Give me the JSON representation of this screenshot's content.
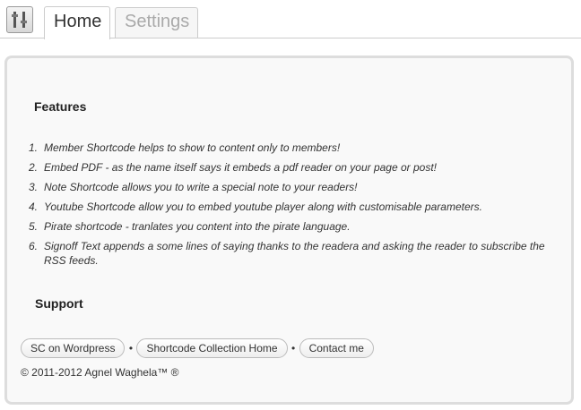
{
  "tabs": {
    "home": "Home",
    "settings": "Settings"
  },
  "features": {
    "heading": "Features",
    "items": [
      {
        "num": "1.",
        "text": "Member Shortcode helps to show to content only to members!"
      },
      {
        "num": "2.",
        "text": "Embed PDF - as the name itself says it embeds a pdf reader on your page or post!"
      },
      {
        "num": "3.",
        "text": "Note Shortcode allows you to write a special note to your readers!"
      },
      {
        "num": "4.",
        "text": "Youtube Shortcode allow you to embed youtube player along with customisable parameters."
      },
      {
        "num": "5.",
        "text": "Pirate shortcode - tranlates you content into the pirate language."
      },
      {
        "num": "6.",
        "text": "Signoff Text appends a some lines of saying thanks to the readera and asking the reader to subscribe the RSS feeds."
      }
    ]
  },
  "support": {
    "heading": "Support",
    "links": [
      "SC on Wordpress",
      "Shortcode Collection Home",
      "Contact me"
    ],
    "separator": "•",
    "copyright": "© 2011-2012 Agnel Waghela™ ®"
  },
  "colors": {
    "panel_background": "#f9f9f9",
    "panel_border": "#dddddd",
    "tab_border": "#cccccc",
    "inactive_tab_text": "#aaaaaa"
  },
  "icons": {
    "plugin": "sliders-icon"
  }
}
